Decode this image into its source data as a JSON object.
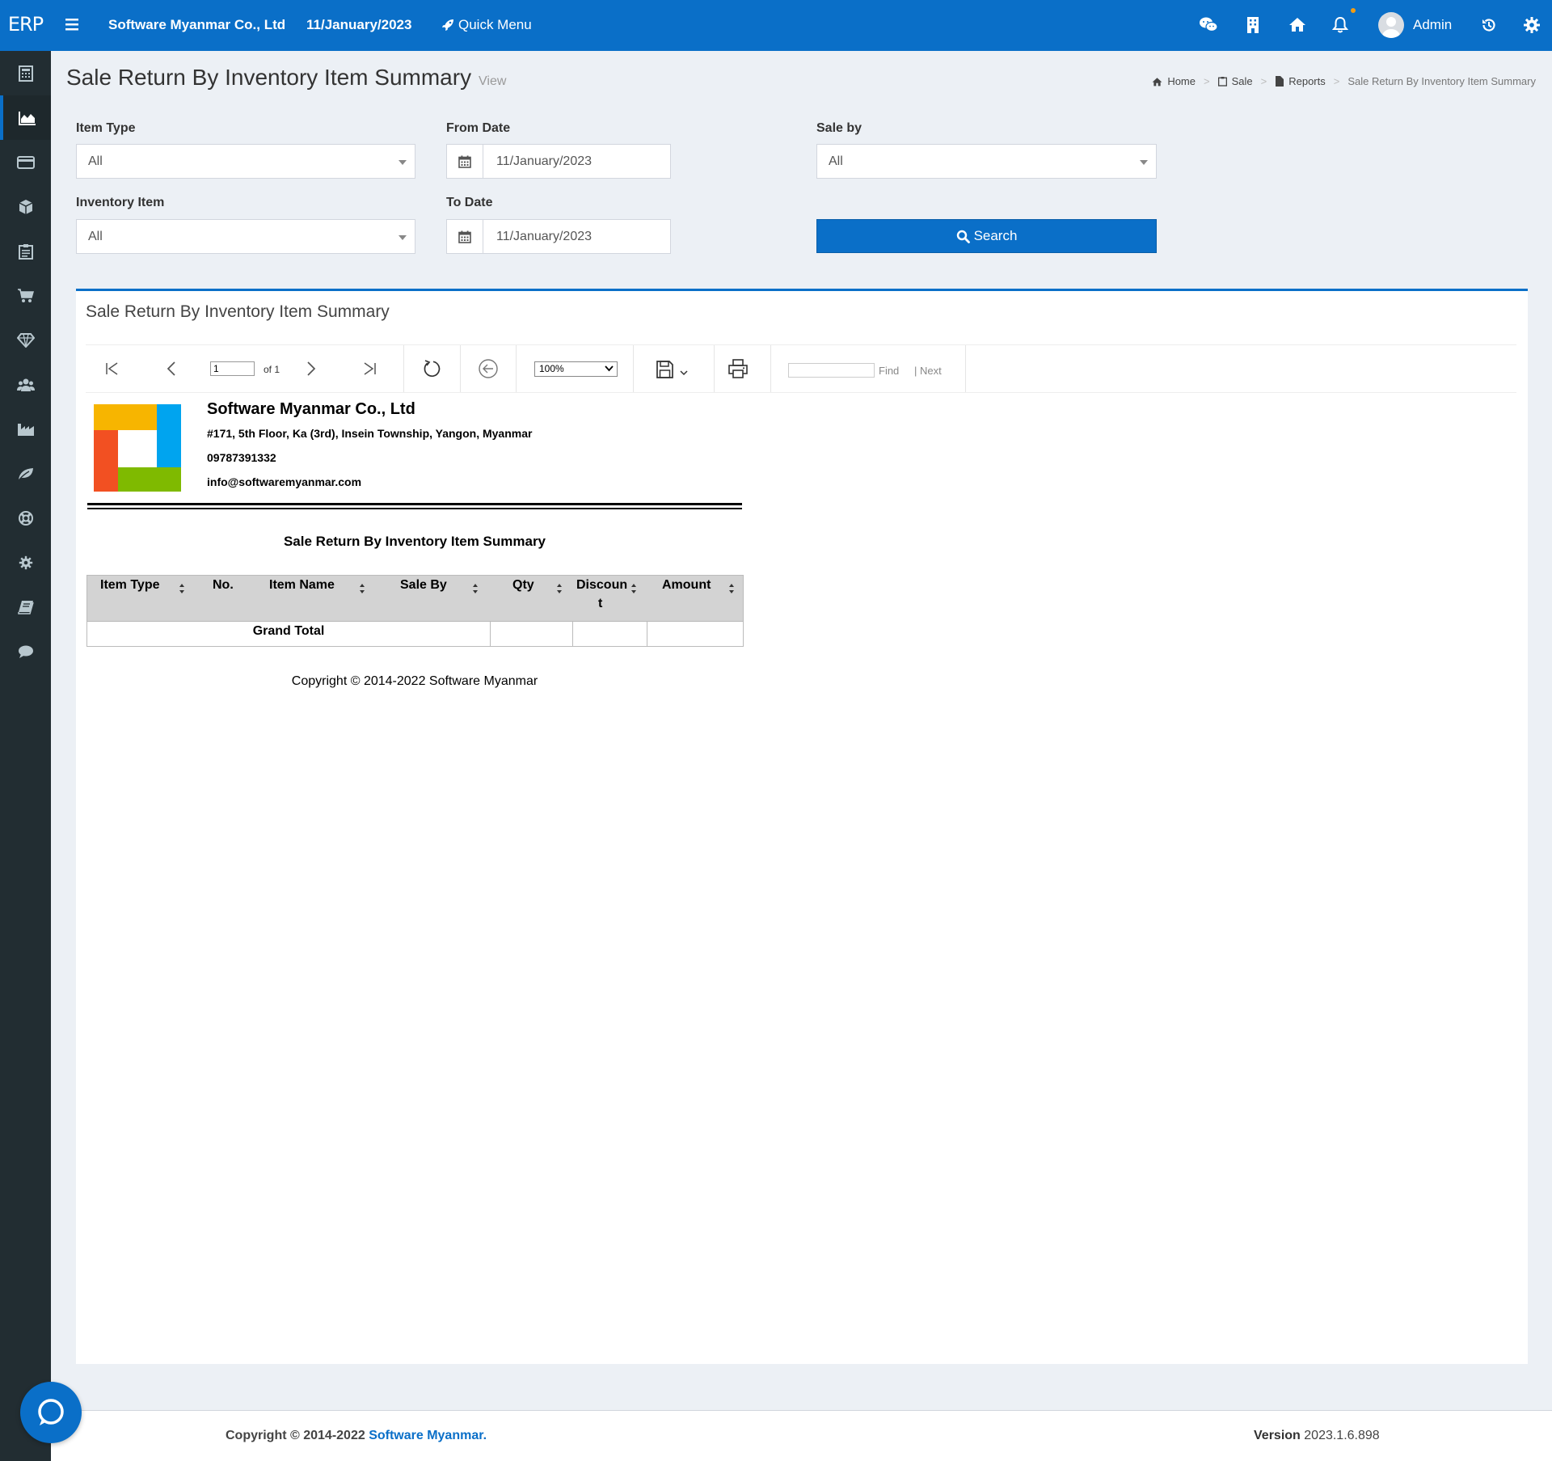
{
  "app": {
    "logo": "ERP",
    "company": "Software Myanmar Co., Ltd",
    "date": "11/January/2023",
    "quick_menu": "Quick Menu",
    "user": "Admin"
  },
  "page": {
    "title": "Sale Return By Inventory Item Summary",
    "subtitle": "View"
  },
  "breadcrumb": {
    "home": "Home",
    "sale": "Sale",
    "reports": "Reports",
    "current": "Sale Return By Inventory Item Summary"
  },
  "filters": {
    "item_type_label": "Item Type",
    "item_type_value": "All",
    "inventory_item_label": "Inventory Item",
    "inventory_item_value": "All",
    "from_date_label": "From Date",
    "from_date_value": "11/January/2023",
    "to_date_label": "To Date",
    "to_date_value": "11/January/2023",
    "sale_by_label": "Sale by",
    "sale_by_value": "All",
    "search_label": "Search"
  },
  "box": {
    "title": "Sale Return By Inventory Item Summary"
  },
  "viewer": {
    "page": "1",
    "of": "of 1",
    "zoom": "100%",
    "find": "Find",
    "next": "Next"
  },
  "report": {
    "company": "Software Myanmar Co., Ltd",
    "address": "#171, 5th Floor, Ka (3rd), Insein Township, Yangon, Myanmar",
    "phone": "09787391332",
    "email": "info@softwaremyanmar.com",
    "title": "Sale Return By Inventory Item Summary",
    "columns": [
      "Item Type",
      "No.",
      "Item Name",
      "Sale By",
      "Qty",
      "Discoun",
      "t",
      "Amount"
    ],
    "grand_total": "Grand Total",
    "copyright": "Copyright © 2014-2022 Software Myanmar"
  },
  "footer": {
    "copyright": "Copyright © 2014-2022 ",
    "link": "Software Myanmar.",
    "version_label": "Version",
    "version": "2023.1.6.898"
  },
  "colors": {
    "primary": "#0a6fc8",
    "sidebar": "#222d32",
    "background": "#ecf0f5",
    "logo_yellow": "#f7b500",
    "logo_blue": "#00a4ef",
    "logo_red": "#f25022",
    "logo_green": "#7fba00"
  }
}
